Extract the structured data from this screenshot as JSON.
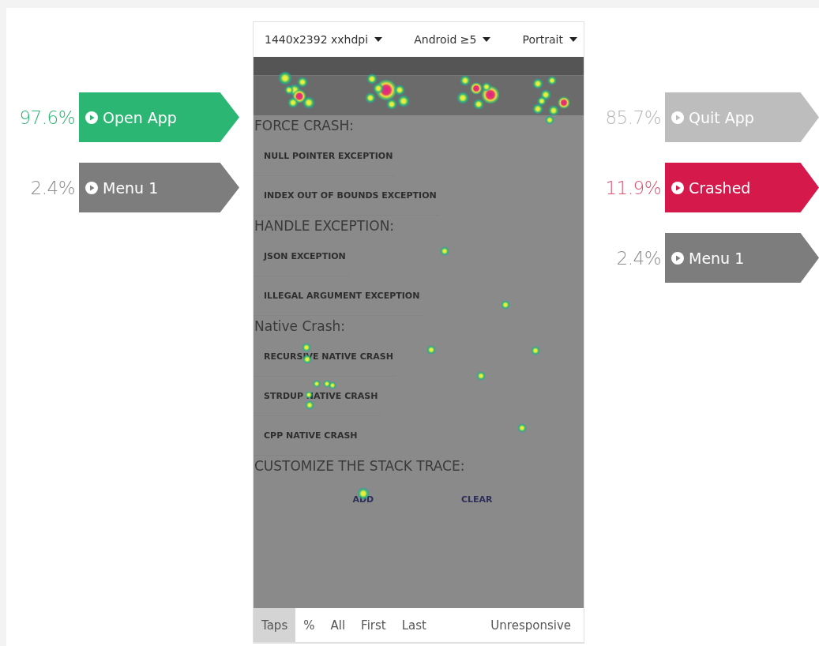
{
  "toolbar": {
    "dropdowns": [
      "1440x2392 xxhdpi",
      "Android ≥5",
      "Portrait"
    ]
  },
  "incoming": [
    {
      "percent": "97.6%",
      "label": "Open App",
      "kind": "primary"
    },
    {
      "percent": "2.4%",
      "label": "Menu 1",
      "kind": "neutral"
    }
  ],
  "outgoing": [
    {
      "percent": "85.7%",
      "label": "Quit App",
      "kind": "muted"
    },
    {
      "percent": "11.9%",
      "label": "Crashed",
      "kind": "danger"
    },
    {
      "percent": "2.4%",
      "label": "Menu 1",
      "kind": "neutral"
    }
  ],
  "app_screen": {
    "sections": [
      {
        "heading": "FORCE CRASH:",
        "items": [
          "NULL POINTER EXCEPTION",
          "INDEX OUT OF BOUNDS EXCEPTION"
        ]
      },
      {
        "heading": "HANDLE EXCEPTION:",
        "items": [
          "JSON EXCEPTION",
          "ILLEGAL ARGUMENT EXCEPTION"
        ]
      },
      {
        "heading": "Native Crash:",
        "items": [
          "RECURSIVE NATIVE CRASH",
          "STRDUP NATIVE CRASH",
          "CPP NATIVE CRASH"
        ]
      },
      {
        "heading": "CUSTOMIZE THE STACK TRACE:"
      }
    ],
    "buttons": [
      "ADD",
      "CLEAR"
    ]
  },
  "view_tabs": [
    {
      "label": "Taps",
      "selected": true
    },
    {
      "label": "%",
      "selected": false
    },
    {
      "label": "All",
      "selected": false
    },
    {
      "label": "First",
      "selected": false
    },
    {
      "label": "Last",
      "selected": false
    },
    {
      "label": "Unresponsive",
      "selected": false
    }
  ]
}
